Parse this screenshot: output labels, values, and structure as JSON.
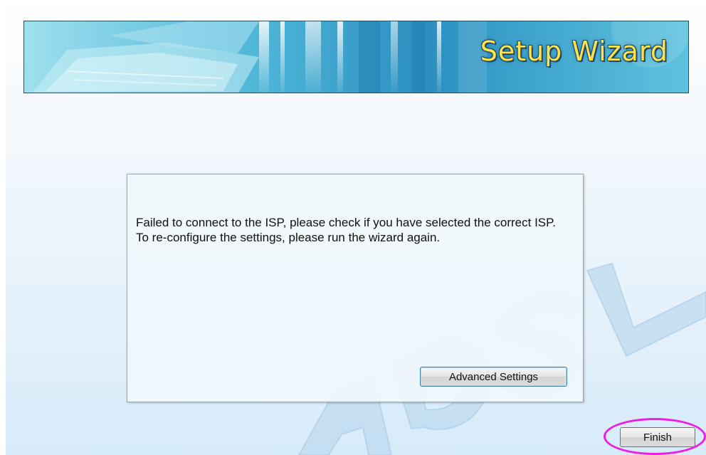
{
  "banner": {
    "title": "Setup Wizard"
  },
  "dialog": {
    "message": "Failed to connect to the ISP, please check if you have selected the correct ISP. To re-configure the settings, please run the wizard again.",
    "advanced_button_label": "Advanced Settings"
  },
  "footer": {
    "finish_button_label": "Finish"
  },
  "watermark": {
    "text": "ADSL"
  },
  "colors": {
    "banner_title": "#ffe24a",
    "highlight_ring": "#ee1ee0",
    "page_background": "#e4f1fb"
  }
}
